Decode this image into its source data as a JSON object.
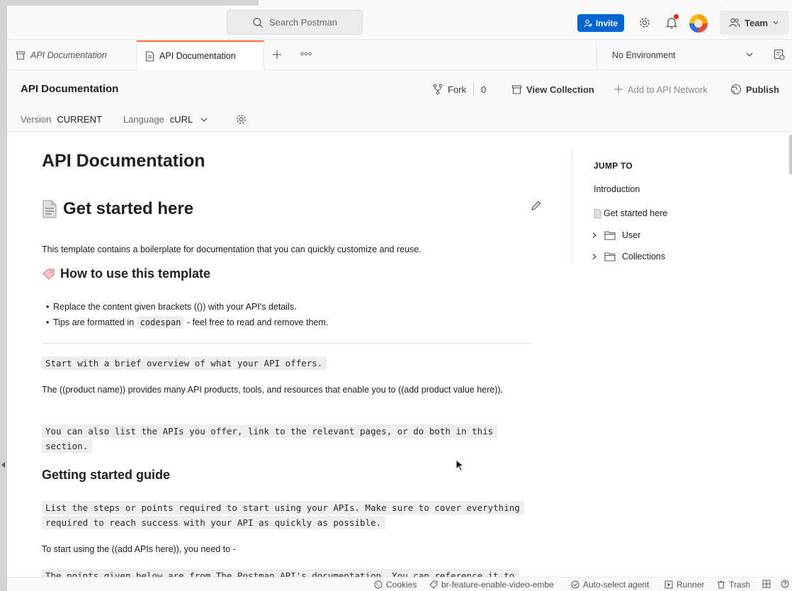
{
  "header": {
    "search_placeholder": "Search Postman",
    "invite_label": "Invite",
    "team_label": "Team"
  },
  "tabs": [
    {
      "label": "API Documentation"
    },
    {
      "label": "API Documentation"
    }
  ],
  "environment": {
    "selected": "No Environment"
  },
  "collection": {
    "title": "API Documentation",
    "fork_label": "Fork",
    "fork_count": "0",
    "view_collection_label": "View Collection",
    "add_network_label": "Add to API Network",
    "publish_label": "Publish",
    "version_label": "Version",
    "version_value": "CURRENT",
    "language_label": "Language",
    "language_value": "cURL"
  },
  "doc": {
    "title": "API Documentation",
    "get_started_heading": "Get started here",
    "intro": "This template contains a boilerplate for documentation that you can quickly customize and reuse.",
    "how_to_heading": "How to use this template",
    "bullet1": "Replace the content given brackets (()) with your API's details.",
    "bullet2_pre": "Tips are formatted in",
    "bullet2_code": "codespan",
    "bullet2_post": "- feel free to read and remove them.",
    "code1": "Start with a brief overview of what your API offers.",
    "para_product": "The ((product name)) provides many API products, tools, and resources that enable you to ((add product value here)).",
    "code2_line1": "You can also list the APIs you offer, link to the relevant pages, or do both in this",
    "code2_line2": "section.",
    "guide_heading": "Getting started guide",
    "code3_line1": "List the steps or points required to start using your APIs. Make sure to cover everything",
    "code3_line2": "required to reach success with your API as quickly as possible.",
    "para_start": "To start using the ((add APIs here)), you need to -",
    "code4": "The points given below are from The Postman API's documentation. You can reference it to"
  },
  "jump_to": {
    "title": "JUMP TO",
    "items": [
      "Introduction",
      "Get started here"
    ],
    "folders": [
      "User",
      "Collections"
    ]
  },
  "footer": {
    "cookies": "Cookies",
    "branch": "br-feature-enable-video-embe",
    "agent": "Auto-select agent",
    "runner": "Runner",
    "trash": "Trash"
  },
  "colors": {
    "accent": "#ff6c37",
    "invite": "#0265d2",
    "notification": "#eb2013"
  }
}
